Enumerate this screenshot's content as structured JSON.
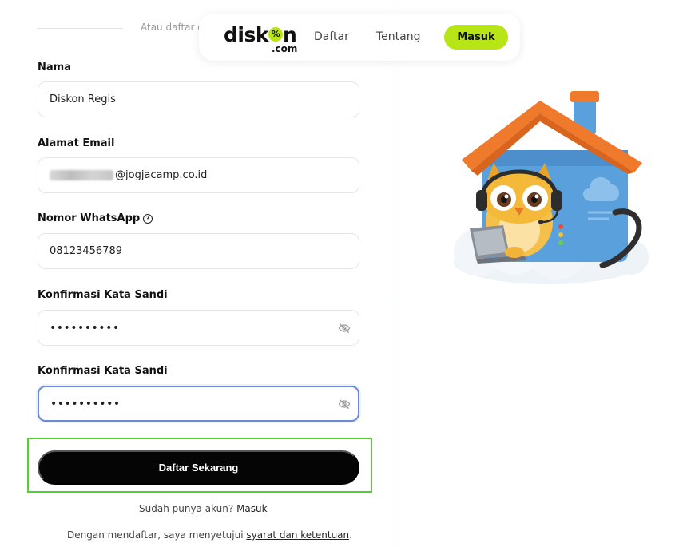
{
  "brand": {
    "logo_main_left": "disk",
    "logo_o_glyph": "%",
    "logo_main_right": "n",
    "logo_sub": ".com",
    "accent": "#b7e515"
  },
  "header_divider_text": "Atau daftar d",
  "nav": {
    "daftar": "Daftar",
    "tentang": "Tentang",
    "masuk": "Masuk"
  },
  "form": {
    "name_label": "Nama",
    "name_value": "Diskon Regis",
    "email_label": "Alamat Email",
    "email_value_suffix": "@jogjacamp.co.id",
    "whatsapp_label": "Nomor WhatsApp",
    "whatsapp_help_icon": "?",
    "whatsapp_value": "08123456789",
    "password_label": "Konfirmasi Kata Sandi",
    "password_value": "••••••••••",
    "confirm_label": "Konfirmasi Kata Sandi",
    "confirm_value": "••••••••••",
    "submit_label": "Daftar Sekarang"
  },
  "footer": {
    "login_prompt": "Sudah punya akun?",
    "login_link": "Masuk",
    "terms_prefix": "Dengan mendaftar, saya menyetujui",
    "terms_link": "syarat dan ketentuan",
    "terms_suffix": "."
  },
  "icons": {
    "eye_off": "eye-off-icon",
    "help": "help-circle-icon"
  },
  "colors": {
    "submit_bg": "#050505",
    "focus_border": "#6d8ad8",
    "highlight_border": "#4cd32c"
  }
}
